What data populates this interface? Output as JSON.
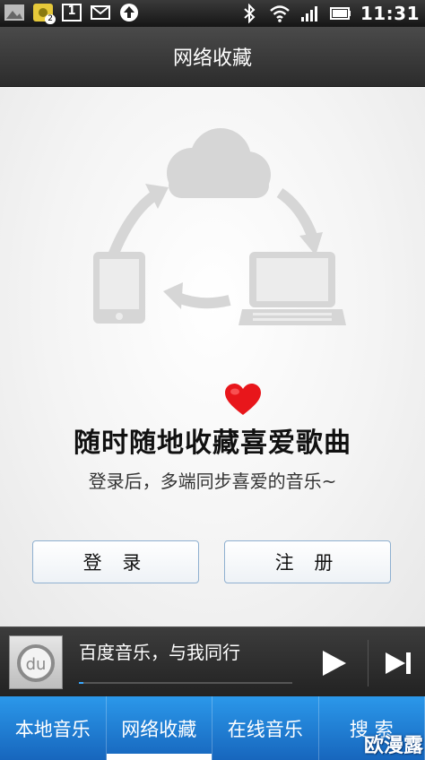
{
  "status_bar": {
    "notification_badge": "2",
    "calendar_day": "1",
    "time": "11:31"
  },
  "title_bar": {
    "title": "网络收藏"
  },
  "main": {
    "headline": "随时随地收藏喜爱歌曲",
    "subline": "登录后，多端同步喜爱的音乐~",
    "login_label": "登 录",
    "register_label": "注 册"
  },
  "player": {
    "album_logo_text": "du",
    "track_text": "百度音乐，与我同行",
    "progress": 0.02
  },
  "tabs": [
    {
      "label": "本地音乐",
      "active": false
    },
    {
      "label": "网络收藏",
      "active": true
    },
    {
      "label": "在线音乐",
      "active": false
    },
    {
      "label": "搜 索",
      "active": false
    }
  ],
  "watermark": "欧漫露",
  "colors": {
    "accent_blue": "#2b98ea",
    "heart_red": "#e8161b",
    "graphic_gray": "#d6d6d6"
  }
}
